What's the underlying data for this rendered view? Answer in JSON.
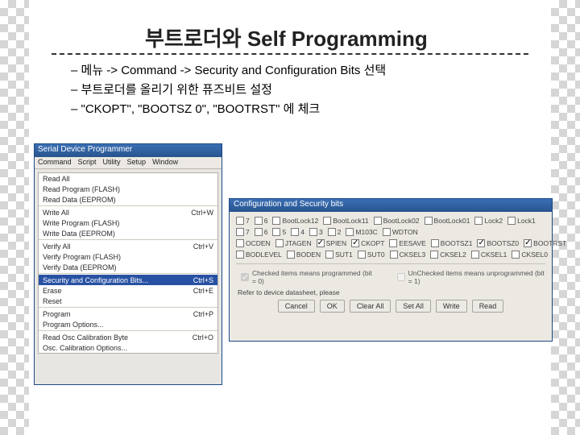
{
  "title": "부트로더와 Self Programming",
  "bullets": [
    "메뉴 -> Command -> Security and Configuration Bits 선택",
    "부트로더를 올리기 위한 퓨즈비트 설정",
    "\"CKOPT\", \"BOOTSZ 0\", \"BOOTRST\" 에 체크"
  ],
  "win1": {
    "title": "Serial Device Programmer",
    "menubar": [
      "Command",
      "Script",
      "Utility",
      "Setup",
      "Window"
    ],
    "items": [
      {
        "label": "Read All",
        "accel": ""
      },
      {
        "label": "Read Program (FLASH)",
        "accel": ""
      },
      {
        "label": "Read Data (EEPROM)",
        "accel": ""
      },
      {
        "sep": true
      },
      {
        "label": "Write All",
        "accel": "Ctrl+W"
      },
      {
        "label": "Write Program (FLASH)",
        "accel": ""
      },
      {
        "label": "Write Data (EEPROM)",
        "accel": ""
      },
      {
        "sep": true
      },
      {
        "label": "Verify All",
        "accel": "Ctrl+V"
      },
      {
        "label": "Verify Program (FLASH)",
        "accel": ""
      },
      {
        "label": "Verify Data (EEPROM)",
        "accel": ""
      },
      {
        "sep": true
      },
      {
        "label": "Security and Configuration Bits...",
        "accel": "Ctrl+S",
        "selected": true
      },
      {
        "label": "Erase",
        "accel": "Ctrl+E"
      },
      {
        "label": "Reset",
        "accel": ""
      },
      {
        "sep": true
      },
      {
        "label": "Program",
        "accel": "Ctrl+P"
      },
      {
        "label": "Program Options...",
        "accel": ""
      },
      {
        "sep": true
      },
      {
        "label": "Read Osc Calibration Byte",
        "accel": "Ctrl+O"
      },
      {
        "label": "Osc. Calibration Options...",
        "accel": ""
      }
    ]
  },
  "win2": {
    "title": "Configuration and Security bits",
    "rows": [
      [
        {
          "label": "7",
          "checked": false
        },
        {
          "label": "6",
          "checked": false
        },
        {
          "label": "BootLock12",
          "checked": false
        },
        {
          "label": "BootLock11",
          "checked": false
        },
        {
          "label": "BootLock02",
          "checked": false
        },
        {
          "label": "BootLock01",
          "checked": false
        },
        {
          "label": "Lock2",
          "checked": false
        },
        {
          "label": "Lock1",
          "checked": false
        }
      ],
      [
        {
          "label": "7",
          "checked": false
        },
        {
          "label": "6",
          "checked": false
        },
        {
          "label": "5",
          "checked": false
        },
        {
          "label": "4",
          "checked": false
        },
        {
          "label": "3",
          "checked": false
        },
        {
          "label": "2",
          "checked": false
        },
        {
          "label": "M103C",
          "checked": false
        },
        {
          "label": "WDTON",
          "checked": false
        }
      ],
      [
        {
          "label": "OCDEN",
          "checked": false
        },
        {
          "label": "JTAGEN",
          "checked": false
        },
        {
          "label": "SPIEN",
          "checked": true
        },
        {
          "label": "CKOPT",
          "checked": true
        },
        {
          "label": "EESAVE",
          "checked": false
        },
        {
          "label": "BOOTSZ1",
          "checked": false
        },
        {
          "label": "BOOTSZ0",
          "checked": true
        },
        {
          "label": "BOOTRST",
          "checked": true
        }
      ],
      [
        {
          "label": "BODLEVEL",
          "checked": false
        },
        {
          "label": "BODEN",
          "checked": false
        },
        {
          "label": "SUT1",
          "checked": false
        },
        {
          "label": "SUT0",
          "checked": false
        },
        {
          "label": "CKSEL3",
          "checked": false
        },
        {
          "label": "CKSEL2",
          "checked": false
        },
        {
          "label": "CKSEL1",
          "checked": false
        },
        {
          "label": "CKSEL0",
          "checked": false
        }
      ]
    ],
    "legend_checked": "Checked items means programmed (bit = 0)",
    "legend_unchecked": "UnChecked items means unprogrammed (bit = 1)",
    "refer": "Refer to device datasheet, please",
    "buttons": [
      "Cancel",
      "OK",
      "Clear All",
      "Set All",
      "Write",
      "Read"
    ]
  }
}
